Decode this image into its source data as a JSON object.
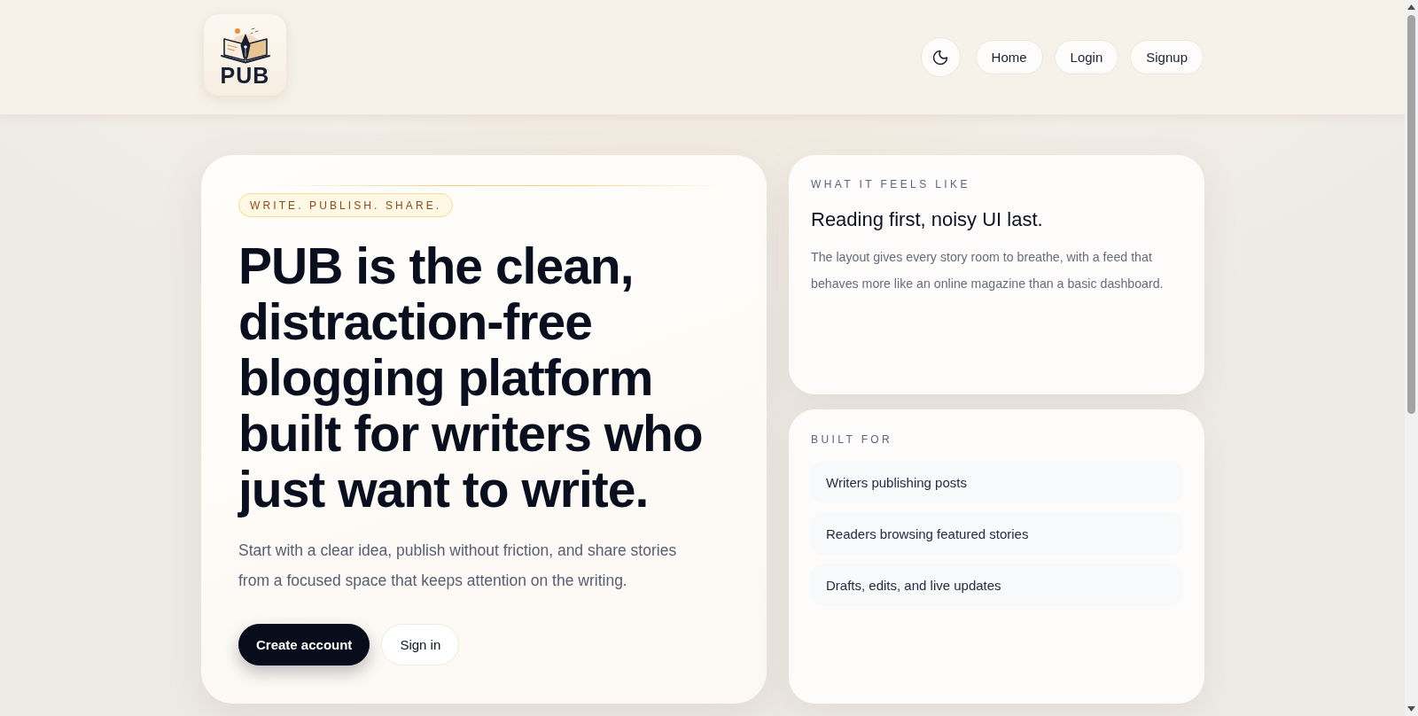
{
  "header": {
    "logo": {
      "text": "PUB"
    },
    "nav": [
      {
        "label": "Home"
      },
      {
        "label": "Login"
      },
      {
        "label": "Signup"
      }
    ]
  },
  "hero": {
    "eyebrow": "WRITE. PUBLISH. SHARE.",
    "headline": "PUB is the clean, distraction-free blogging platform built for writers who just want to write.",
    "lead": "Start with a clear idea, publish without friction, and share stories from a focused space that keeps attention on the writing.",
    "actions": [
      {
        "label": "Create account",
        "kind": "primary"
      },
      {
        "label": "Sign in",
        "kind": "secondary"
      }
    ]
  },
  "feel_card": {
    "eyebrow": "WHAT IT FEELS LIKE",
    "title": "Reading first, noisy UI last.",
    "body": "The layout gives every story room to breathe, with a feed that behaves more like an online magazine than a basic dashboard."
  },
  "audience_card": {
    "eyebrow": "BUILT FOR",
    "items": [
      "Writers publishing posts",
      "Readers browsing featured stories",
      "Drafts, edits, and live updates"
    ]
  }
}
